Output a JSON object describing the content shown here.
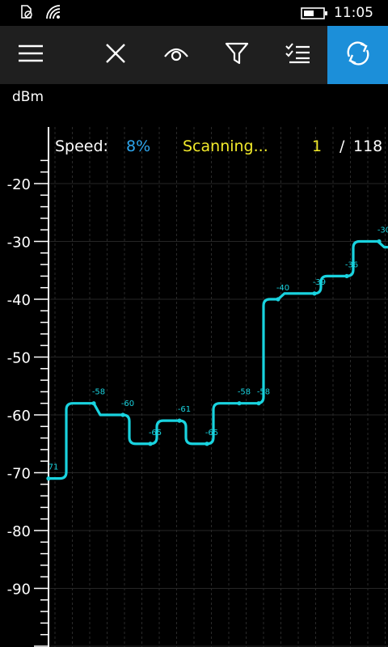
{
  "status_bar": {
    "time": "11:05",
    "icons": [
      "call-forwarding-icon",
      "wifi-signal-icon",
      "battery-icon"
    ]
  },
  "toolbar": {
    "buttons": [
      {
        "name": "menu-button",
        "icon": "hamburger-icon"
      },
      {
        "name": "close-button",
        "icon": "close-icon"
      },
      {
        "name": "view-button",
        "icon": "eye-icon"
      },
      {
        "name": "filter-button",
        "icon": "filter-icon"
      },
      {
        "name": "checklist-button",
        "icon": "checklist-icon"
      },
      {
        "name": "refresh-button",
        "icon": "refresh-icon",
        "active": true
      }
    ],
    "accent_color": "#1c8fd9"
  },
  "scan": {
    "speed_label": "Speed:",
    "speed_value": "8%",
    "status": "Scanning...",
    "current": "1",
    "separator": "/",
    "total": "118"
  },
  "chart_data": {
    "type": "line",
    "ylabel": "dBm",
    "yticks": [
      "-20",
      "-30",
      "-40",
      "-50",
      "-60",
      "-70",
      "-80",
      "-90"
    ],
    "ylim": [
      -100,
      -10
    ],
    "grid": true,
    "line_color": "#19d3df",
    "series": [
      {
        "values": [
          -71,
          -58,
          -60,
          -65,
          -61,
          -65,
          -58,
          -58,
          -40,
          -39,
          -36,
          -30,
          -31
        ]
      }
    ],
    "point_labels": [
      "71",
      "-58",
      "-60",
      "-65",
      "-61",
      "-65",
      "-58",
      "-58",
      "-40",
      "-39",
      "-36",
      "-30",
      "-3"
    ]
  }
}
